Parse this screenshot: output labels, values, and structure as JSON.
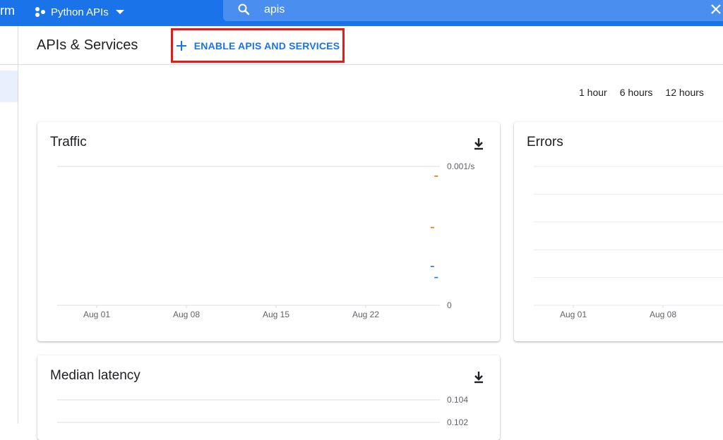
{
  "topbar": {
    "brand_tail": "rm",
    "project_name": "Python APIs",
    "search_value": "apis"
  },
  "header": {
    "title": "APIs & Services",
    "enable_button_label": "ENABLE APIS AND SERVICES"
  },
  "time_range": [
    "1 hour",
    "6 hours",
    "12 hours"
  ],
  "icons": {
    "project": "project-dots-icon",
    "search": "search-icon",
    "clear": "close-icon",
    "enable": "plus-icon",
    "download": "download-icon"
  },
  "colors": {
    "topbar": "#1a73e8",
    "accent": "#1a73e8",
    "highlight_border": "#e01c1c",
    "series_orange": "#e8710a",
    "series_blue": "#1a73e8"
  },
  "cards": {
    "traffic": {
      "title": "Traffic"
    },
    "errors": {
      "title": "Errors"
    },
    "latency": {
      "title": "Median latency"
    }
  },
  "chart_data": [
    {
      "type": "line",
      "title": "Traffic",
      "x_ticks": [
        "Aug 01",
        "Aug 08",
        "Aug 15",
        "Aug 22"
      ],
      "y_ticks": [
        "0.001/s",
        "0"
      ],
      "ylim": [
        0,
        0.001
      ],
      "grid": true,
      "series": [
        {
          "color": "#e8710a",
          "points": [
            [
              27.5,
              0.00093
            ],
            [
              27.2,
              0.00056
            ]
          ]
        },
        {
          "color": "#1a73e8",
          "points": [
            [
              27.2,
              0.00028
            ],
            [
              27.5,
              0.0002
            ]
          ]
        }
      ]
    },
    {
      "type": "line",
      "title": "Errors",
      "x_ticks": [
        "Aug 01",
        "Aug 08"
      ],
      "y_ticks": [],
      "grid": true,
      "series": []
    },
    {
      "type": "line",
      "title": "Median latency",
      "x_ticks": [],
      "y_ticks": [
        "0.104",
        "0.102"
      ],
      "grid": true,
      "series": []
    }
  ]
}
